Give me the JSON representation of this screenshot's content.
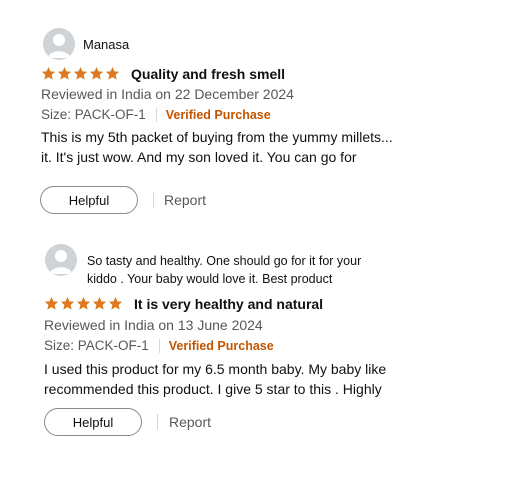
{
  "colors": {
    "star": "#de7921",
    "verified": "#c45500",
    "muted": "#565959",
    "text": "#0f1111"
  },
  "icons": {
    "avatar": "user-silhouette-icon",
    "star": "star-filled-icon"
  },
  "reviews": [
    {
      "profile_name": "Manasa",
      "profile_note": "",
      "rating": 5,
      "title": "Quality and fresh smell",
      "date_line": "Reviewed in India on 22 December 2024",
      "size_label": "Size: PACK-OF-1",
      "verified_label": "Verified Purchase",
      "body_line1": "This is my 5th packet of buying from the yummy millets...",
      "body_line2": "it.  It's just wow. And my son loved it. You can go for",
      "helpful_label": "Helpful",
      "report_label": "Report"
    },
    {
      "profile_name": "",
      "profile_note_line1": "So tasty and healthy. One should go for it for your",
      "profile_note_line2": "kiddo . Your baby would love it. Best product",
      "rating": 5,
      "title": "It is very healthy and natural",
      "date_line": "Reviewed in India on 13 June 2024",
      "size_label": "Size: PACK-OF-1",
      "verified_label": "Verified Purchase",
      "body_line1": "I used this product for my 6.5 month baby. My baby like",
      "body_line2": "recommended  this product. I give 5 star to this . Highly",
      "helpful_label": "Helpful",
      "report_label": "Report"
    }
  ]
}
